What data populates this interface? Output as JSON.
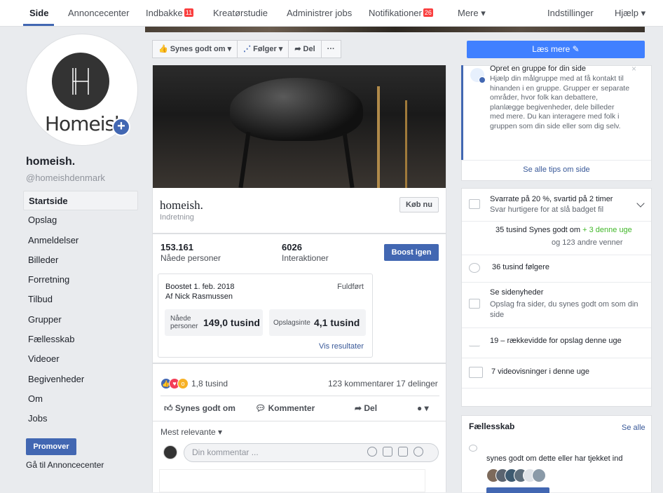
{
  "nav": {
    "items": [
      {
        "label": "Side"
      },
      {
        "label": "Annoncecenter"
      },
      {
        "label": "Indbakke",
        "badge": "11"
      },
      {
        "label": "Kreatørstudie"
      },
      {
        "label": "Administrer jobs"
      },
      {
        "label": "Notifikationer",
        "badge": "26"
      },
      {
        "label": "Mere ▾"
      },
      {
        "label": "Indstillinger"
      },
      {
        "label": "Hjælp ▾"
      }
    ]
  },
  "profile": {
    "logo_text": "Homeish",
    "name": "homeish.",
    "handle": "@homeishdenmark"
  },
  "left_menu": [
    "Startside",
    "Opslag",
    "Anmeldelser",
    "Billeder",
    "Forretning",
    "Tilbud",
    "Grupper",
    "Fællesskab",
    "Videoer",
    "Begivenheder",
    "Om",
    "Jobs"
  ],
  "left_actions": {
    "promote": "Promover",
    "ads_center": "Gå til Annoncecenter"
  },
  "actionbar": {
    "like": "Synes godt om ▾",
    "follow": "Følger ▾",
    "share": "Del",
    "more": "···",
    "read_more": "Læs mere ✎"
  },
  "post": {
    "biz_name": "homeish.",
    "category": "Indretning",
    "buy_button": "Køb nu",
    "reach_num": "153.161",
    "reach_label": "Nåede personer",
    "inter_num": "6026",
    "inter_label": "Interaktioner",
    "boost_button": "Boost igen",
    "boost": {
      "date": "Boostet 1. feb. 2018",
      "by": "Af Nick Rasmussen",
      "status": "Fuldført",
      "tile1_label": "Nåede personer",
      "tile1_value": "149,0 tusind",
      "tile2_label": "Opslagsinte",
      "tile2_value": "4,1 tusind",
      "results": "Vis resultater"
    },
    "reaction_count": "1,8 tusind",
    "comments_shares": "123 kommentarer  17 delinger",
    "act_like": "Synes godt om",
    "act_comment": "Kommenter",
    "act_share": "Del",
    "sort": "Mest relevante ▾",
    "comment_placeholder": "Din kommentar ..."
  },
  "right": {
    "tip_title": "Opret en gruppe for din side",
    "tip_text": "Hjælp din målgruppe med at få kontakt til hinanden i en gruppe. Grupper er separate områder, hvor folk kan debattere, planlægge begivenheder, dele billeder med mere. Du kan interagere med folk i gruppen som din side eller som dig selv.",
    "tip_close": "×",
    "tips_link": "Se alle tips om side",
    "response_title": "Svarrate på 20 %, svartid på 2 timer",
    "response_sub": "Svar hurtigere for at slå badget fil",
    "likes": "35 tusind Synes godt om",
    "likes_delta": "+ 3 denne uge",
    "likes_friends": "og 123 andre venner",
    "followers": "36 tusind følgere",
    "news_title": "Se sidenyheder",
    "news_sub": "Opslag fra sider, du synes godt om som din side",
    "reach": "19 – rækkevidde for opslag denne uge",
    "videos": "7 videovisninger i denne uge",
    "community_title": "Fællesskab",
    "community_all": "Se alle",
    "community_text": "synes godt om dette eller har tjekket ind"
  }
}
